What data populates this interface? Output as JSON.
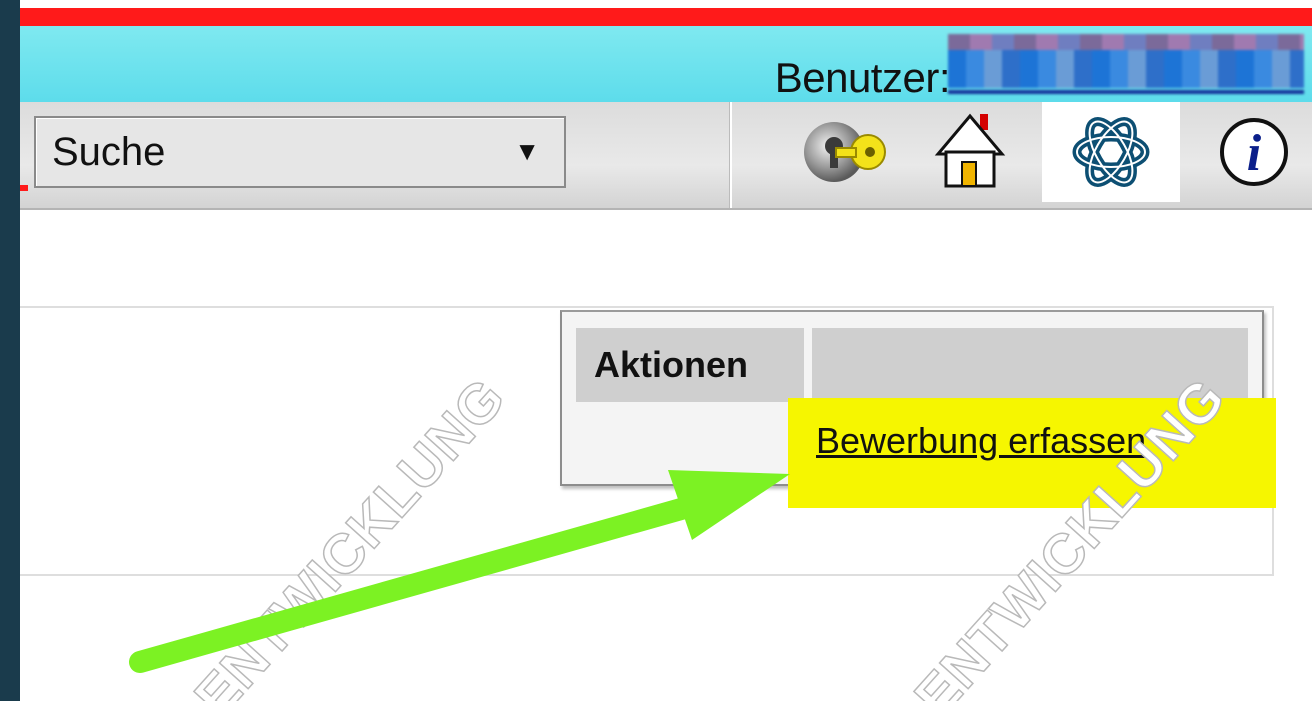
{
  "header": {
    "user_label": "Benutzer:",
    "user_value_state": "redacted"
  },
  "toolbar": {
    "search_select": {
      "selected": "Suche",
      "arrow": "▼"
    },
    "icons": [
      "key-icon",
      "home-icon",
      "logo-icon",
      "info-icon"
    ],
    "info_glyph": "i"
  },
  "actions": {
    "header": "Aktionen",
    "links": [
      {
        "label": "Bewerbung erfassen"
      }
    ]
  },
  "annotations": {
    "arrow_color": "#7cf223",
    "highlight_color": "#f6f600",
    "watermark_text": "ENTWICKLUNG"
  },
  "colors": {
    "header_red": "#ff1a1a",
    "header_cyan": "#5ddceb",
    "toolbar_gray": "#dcdcdc",
    "frame": "#1a3b4c"
  }
}
